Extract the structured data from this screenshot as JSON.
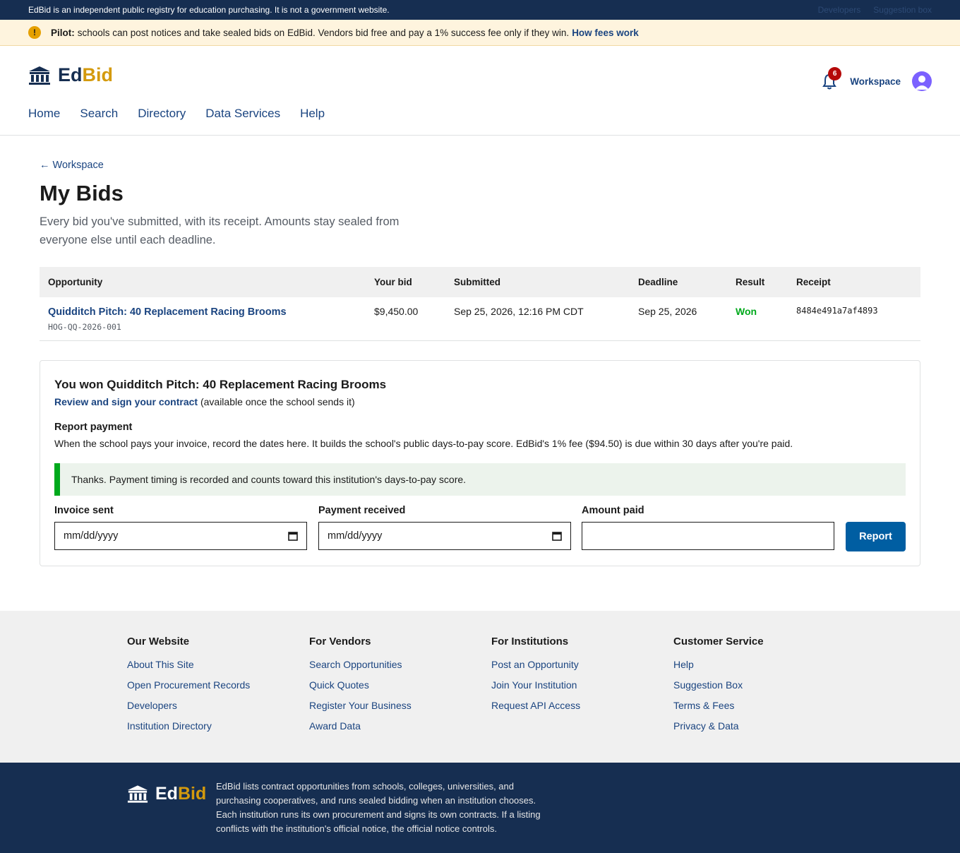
{
  "topbar": {
    "disclaimer": "EdBid is an independent public registry for education purchasing. It is not a government website.",
    "links": [
      "Developers",
      "Suggestion box"
    ]
  },
  "pilot": {
    "label": "Pilot:",
    "message": "schools can post notices and take sealed bids on EdBid. Vendors bid free and pay a 1% success fee only if they win.",
    "link": "How fees work"
  },
  "header": {
    "logo_ed": "Ed",
    "logo_bid": "Bid",
    "nav": [
      "Home",
      "Search",
      "Directory",
      "Data Services",
      "Help"
    ],
    "notification_count": "6",
    "workspace": "Workspace"
  },
  "page": {
    "back_link": "← Workspace",
    "title": "My Bids",
    "description": "Every bid you've submitted, with its receipt. Amounts stay sealed from everyone else until each deadline."
  },
  "table": {
    "headers": [
      "Opportunity",
      "Your bid",
      "Submitted",
      "Deadline",
      "Result",
      "Receipt"
    ],
    "rows": [
      {
        "title": "Quidditch Pitch: 40 Replacement Racing Brooms",
        "id": "HOG-QQ-2026-001",
        "bid": "$9,450.00",
        "submitted": "Sep 25, 2026, 12:16 PM CDT",
        "deadline": "Sep 25, 2026",
        "result": "Won",
        "receipt": "8484e491a7af4893"
      }
    ]
  },
  "card": {
    "title": "You won Quidditch Pitch: 40 Replacement Racing Brooms",
    "contract_link": "Review and sign your contract",
    "contract_note": "(available once the school sends it)",
    "report_heading": "Report payment",
    "report_desc": "When the school pays your invoice, record the dates here. It builds the school's public days-to-pay score. EdBid's 1% fee ($94.50) is due within 30 days after you're paid.",
    "alert": "Thanks. Payment timing is recorded and counts toward this institution's days-to-pay score.",
    "invoice_label": "Invoice sent",
    "invoice_value": "mm/dd/yyyy",
    "payment_label": "Payment received",
    "payment_value": "mm/dd/yyyy",
    "amount_label": "Amount paid",
    "amount_value": "",
    "button": "Report"
  },
  "footer": {
    "columns": [
      {
        "heading": "Our Website",
        "links": [
          "About This Site",
          "Open Procurement Records",
          "Developers",
          "Institution Directory"
        ]
      },
      {
        "heading": "For Vendors",
        "links": [
          "Search Opportunities",
          "Quick Quotes",
          "Register Your Business",
          "Award Data"
        ]
      },
      {
        "heading": "For Institutions",
        "links": [
          "Post an Opportunity",
          "Join Your Institution",
          "Request API Access"
        ]
      },
      {
        "heading": "Customer Service",
        "links": [
          "Help",
          "Suggestion Box",
          "Terms & Fees",
          "Privacy & Data"
        ]
      }
    ],
    "logo_ed": "Ed",
    "logo_bid": "Bid",
    "text": "EdBid lists contract opportunities from schools, colleges, universities, and purchasing cooperatives, and runs sealed bidding when an institution chooses. Each institution runs its own procurement and signs its own contracts. If a listing conflicts with the institution's official notice, the official notice controls."
  }
}
